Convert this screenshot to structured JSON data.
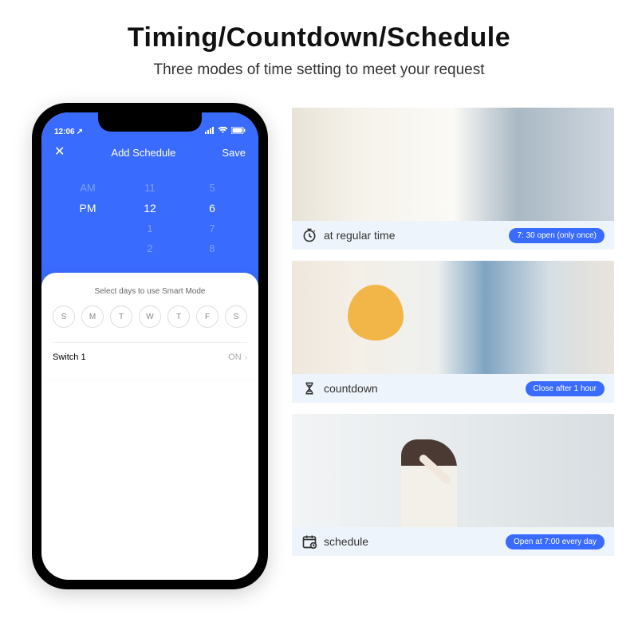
{
  "header": {
    "title": "Timing/Countdown/Schedule",
    "subtitle": "Three modes of time setting to meet your request"
  },
  "phone": {
    "status": {
      "time": "12:06",
      "arrow": "↗"
    },
    "nav": {
      "close": "✕",
      "title": "Add Schedule",
      "save": "Save"
    },
    "picker": {
      "col1": {
        "above": "AM",
        "sel": "PM",
        "below1": "",
        "below2": ""
      },
      "col2": {
        "above": "11",
        "sel": "12",
        "below1": "1",
        "below2": "2"
      },
      "col3": {
        "above": "5",
        "sel": "6",
        "below1": "7",
        "below2": "8"
      }
    },
    "card": {
      "title": "Select days to use Smart Mode",
      "days": [
        "S",
        "M",
        "T",
        "W",
        "T",
        "F",
        "S"
      ],
      "switch": {
        "label": "Switch 1",
        "value": "ON"
      }
    }
  },
  "panels": [
    {
      "label": "at regular time",
      "pill": "7: 30 open (only once)",
      "icon": "clock"
    },
    {
      "label": "countdown",
      "pill": "Close after 1 hour",
      "icon": "hourglass"
    },
    {
      "label": "schedule",
      "pill": "Open at 7:00 every day",
      "icon": "calendar"
    }
  ]
}
